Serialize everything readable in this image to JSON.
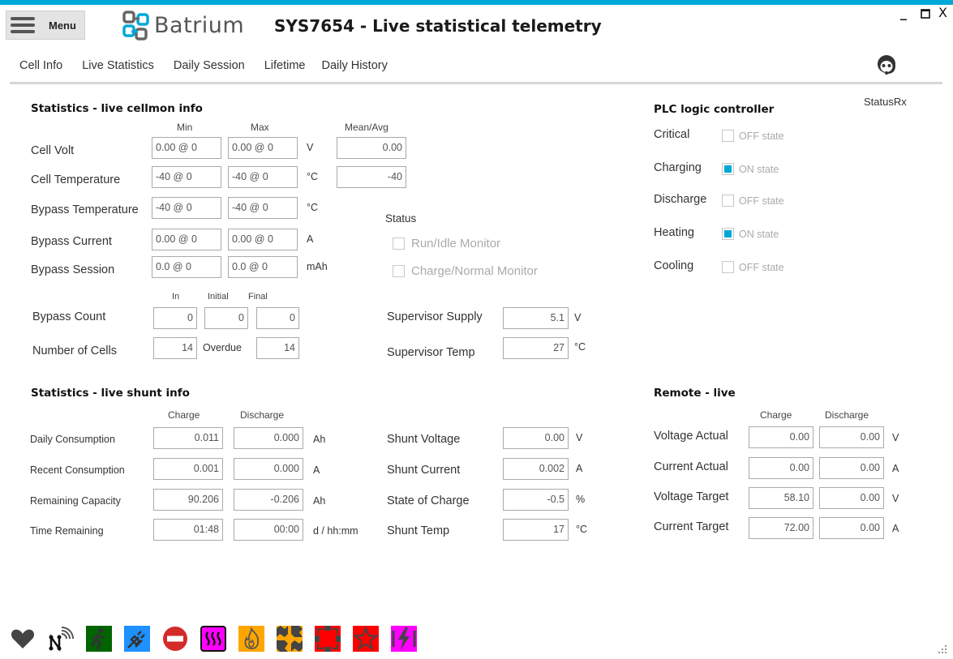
{
  "header": {
    "menu_label": "Menu",
    "brand": "Batrium",
    "title": "SYS7654 - Live statistical telemetry",
    "window_controls": {
      "minimize": "_",
      "maximize": "☐",
      "close": "X"
    }
  },
  "tabs": [
    {
      "label": "Cell Info",
      "active": false
    },
    {
      "label": "Live Statistics",
      "active": true
    },
    {
      "label": "Daily Session",
      "active": false
    },
    {
      "label": "Lifetime",
      "active": false
    },
    {
      "label": "Daily History",
      "active": false
    }
  ],
  "colors": {
    "accent": "#00a8d8"
  },
  "cellmon": {
    "heading": "Statistics - live cellmon info",
    "col_min": "Min",
    "col_max": "Max",
    "col_mean": "Mean/Avg",
    "rows": [
      {
        "label": "Cell Volt",
        "min": "0.00 @ 0",
        "max": "0.00 @ 0",
        "unit": "V",
        "mean": "0.00"
      },
      {
        "label": "Cell Temperature",
        "min": "-40 @ 0",
        "max": "-40 @ 0",
        "unit": "°C",
        "mean": "-40"
      },
      {
        "label": "Bypass Temperature",
        "min": "-40 @ 0",
        "max": "-40 @ 0",
        "unit": "°C"
      },
      {
        "label": "Bypass Current",
        "min": "0.00 @ 0",
        "max": "0.00 @ 0",
        "unit": "A"
      },
      {
        "label": "Bypass Session",
        "min": "0.0 @ 0",
        "max": "0.0 @ 0",
        "unit": "mAh"
      }
    ],
    "status": {
      "label": "Status",
      "run_idle": {
        "label": "Run/Idle Monitor",
        "checked": false
      },
      "charge_normal": {
        "label": "Charge/Normal Monitor",
        "checked": false
      }
    },
    "bypass_count": {
      "col_in": "In",
      "col_initial": "Initial",
      "col_final": "Final",
      "label": "Bypass Count",
      "in": "0",
      "initial": "0",
      "final": "0"
    },
    "number_of_cells": {
      "label": "Number of Cells",
      "value": "14",
      "overdue_label": "Overdue",
      "overdue": "14"
    },
    "supervisor_supply": {
      "label": "Supervisor Supply",
      "value": "5.1",
      "unit": "V"
    },
    "supervisor_temp": {
      "label": "Supervisor Temp",
      "value": "27",
      "unit": "°C"
    }
  },
  "plc": {
    "heading": "PLC logic controller",
    "status_rx": "StatusRx",
    "rows": [
      {
        "label": "Critical",
        "checked": false,
        "state": "OFF state"
      },
      {
        "label": "Charging",
        "checked": true,
        "state": "ON state"
      },
      {
        "label": "Discharge",
        "checked": false,
        "state": "OFF state"
      },
      {
        "label": "Heating",
        "checked": true,
        "state": "ON state"
      },
      {
        "label": "Cooling",
        "checked": false,
        "state": "OFF state"
      }
    ]
  },
  "shunt": {
    "heading": "Statistics - live shunt info",
    "col_charge": "Charge",
    "col_discharge": "Discharge",
    "rows": [
      {
        "label": "Daily Consumption",
        "charge": "0.011",
        "discharge": "0.000",
        "unit": "Ah"
      },
      {
        "label": "Recent Consumption",
        "charge": "0.001",
        "discharge": "0.000",
        "unit": "A"
      },
      {
        "label": "Remaining Capacity",
        "charge": "90.206",
        "discharge": "-0.206",
        "unit": "Ah"
      },
      {
        "label": "Time Remaining",
        "charge": "01:48",
        "discharge": "00:00",
        "unit": "d / hh:mm"
      }
    ],
    "readings": [
      {
        "label": "Shunt Voltage",
        "value": "0.00",
        "unit": "V"
      },
      {
        "label": "Shunt Current",
        "value": "0.002",
        "unit": "A"
      },
      {
        "label": "State of Charge",
        "value": "-0.5",
        "unit": "%"
      },
      {
        "label": "Shunt Temp",
        "value": "17",
        "unit": "°C"
      }
    ]
  },
  "remote": {
    "heading": "Remote - live",
    "col_charge": "Charge",
    "col_discharge": "Discharge",
    "rows": [
      {
        "label": "Voltage Actual",
        "charge": "0.00",
        "discharge": "0.00",
        "unit": "V"
      },
      {
        "label": "Current Actual",
        "charge": "0.00",
        "discharge": "0.00",
        "unit": "A"
      },
      {
        "label": "Voltage Target",
        "charge": "58.10",
        "discharge": "0.00",
        "unit": "V"
      },
      {
        "label": "Current Target",
        "charge": "72.00",
        "discharge": "0.00",
        "unit": "A"
      }
    ]
  },
  "status_icons": [
    {
      "name": "heartbeat-icon",
      "bg": "none"
    },
    {
      "name": "network-signal-icon",
      "bg": "none"
    },
    {
      "name": "emergency-exit-icon",
      "bg": "#006400"
    },
    {
      "name": "power-plug-icon",
      "bg": "#1e90ff"
    },
    {
      "name": "no-entry-icon",
      "bg": "none"
    },
    {
      "name": "heater-icon",
      "bg": "#ff00ff"
    },
    {
      "name": "fire-icon",
      "bg": "#ffa500"
    },
    {
      "name": "cell-balance-icon",
      "bg": "#ffa500"
    },
    {
      "name": "fault-expand-icon",
      "bg": "#ff0000"
    },
    {
      "name": "star-alert-icon",
      "bg": "#ff0000"
    },
    {
      "name": "lightning-icon",
      "bg": "#ff00ff"
    }
  ]
}
